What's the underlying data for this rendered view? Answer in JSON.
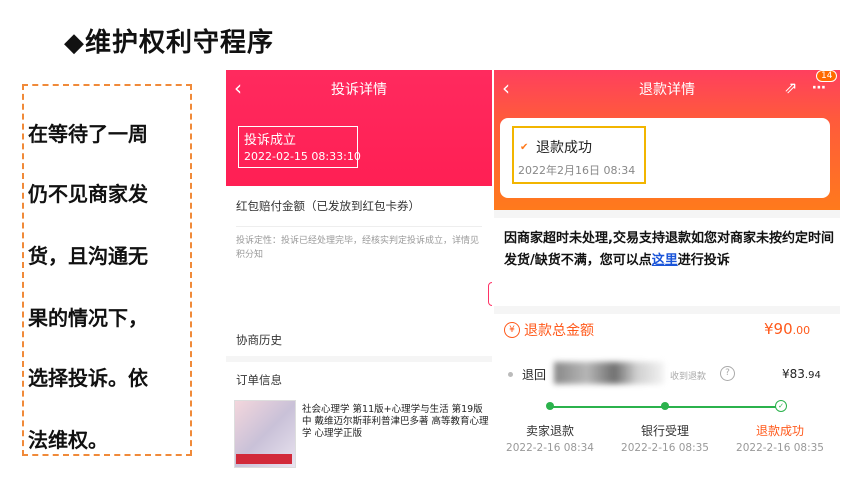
{
  "slide": {
    "title": "◆维护权利守程序",
    "note_lines": [
      "在等待了一周",
      "仍不见商家发",
      "货，且沟通无",
      "果的情况下，",
      "选择投诉。依",
      "法维权。"
    ]
  },
  "complaint_screen": {
    "back": "‹",
    "title": "投诉详情",
    "status": "投诉成立",
    "status_date": "2022-02-15 08:33:10",
    "compensation": "红包赔付金额（已发放到红包卡券）",
    "note": "投诉定性：投诉已经处理完毕，经核实判定投诉成立，详情见积分知",
    "history": "协商历史",
    "order_info": "订单信息",
    "product_title": "社会心理学 第11版+心理学与生活 第19版 中 戴维迈尔斯菲利普津巴多著 高等教育心理学 心理学正版"
  },
  "refund_screen": {
    "back": "‹",
    "title": "退款详情",
    "badge": "14",
    "status": "退款成功",
    "status_date": "2022年2月16日 08:34",
    "message_pre": "因商家超时未处理,交易支持退款如您对商家未按约定时间发货/缺货不满，您可以点",
    "message_link": "这里",
    "message_post": "进行投诉",
    "total_label": "退款总金额",
    "total_value": "¥90",
    "total_cents": ".00",
    "return_label": "退回",
    "account_label": "收到退款",
    "return_amount": "¥83",
    "return_cents": ".94",
    "steps": [
      {
        "label": "卖家退款",
        "date": "2022-2-16 08:34"
      },
      {
        "label": "银行受理",
        "date": "2022-2-16 08:35"
      },
      {
        "label": "退款成功",
        "date": "2022-2-16 08:35"
      }
    ],
    "colors": {
      "accent": "#ff5a1c",
      "progress": "#2bb24c",
      "highlight": "#f2b500"
    }
  }
}
